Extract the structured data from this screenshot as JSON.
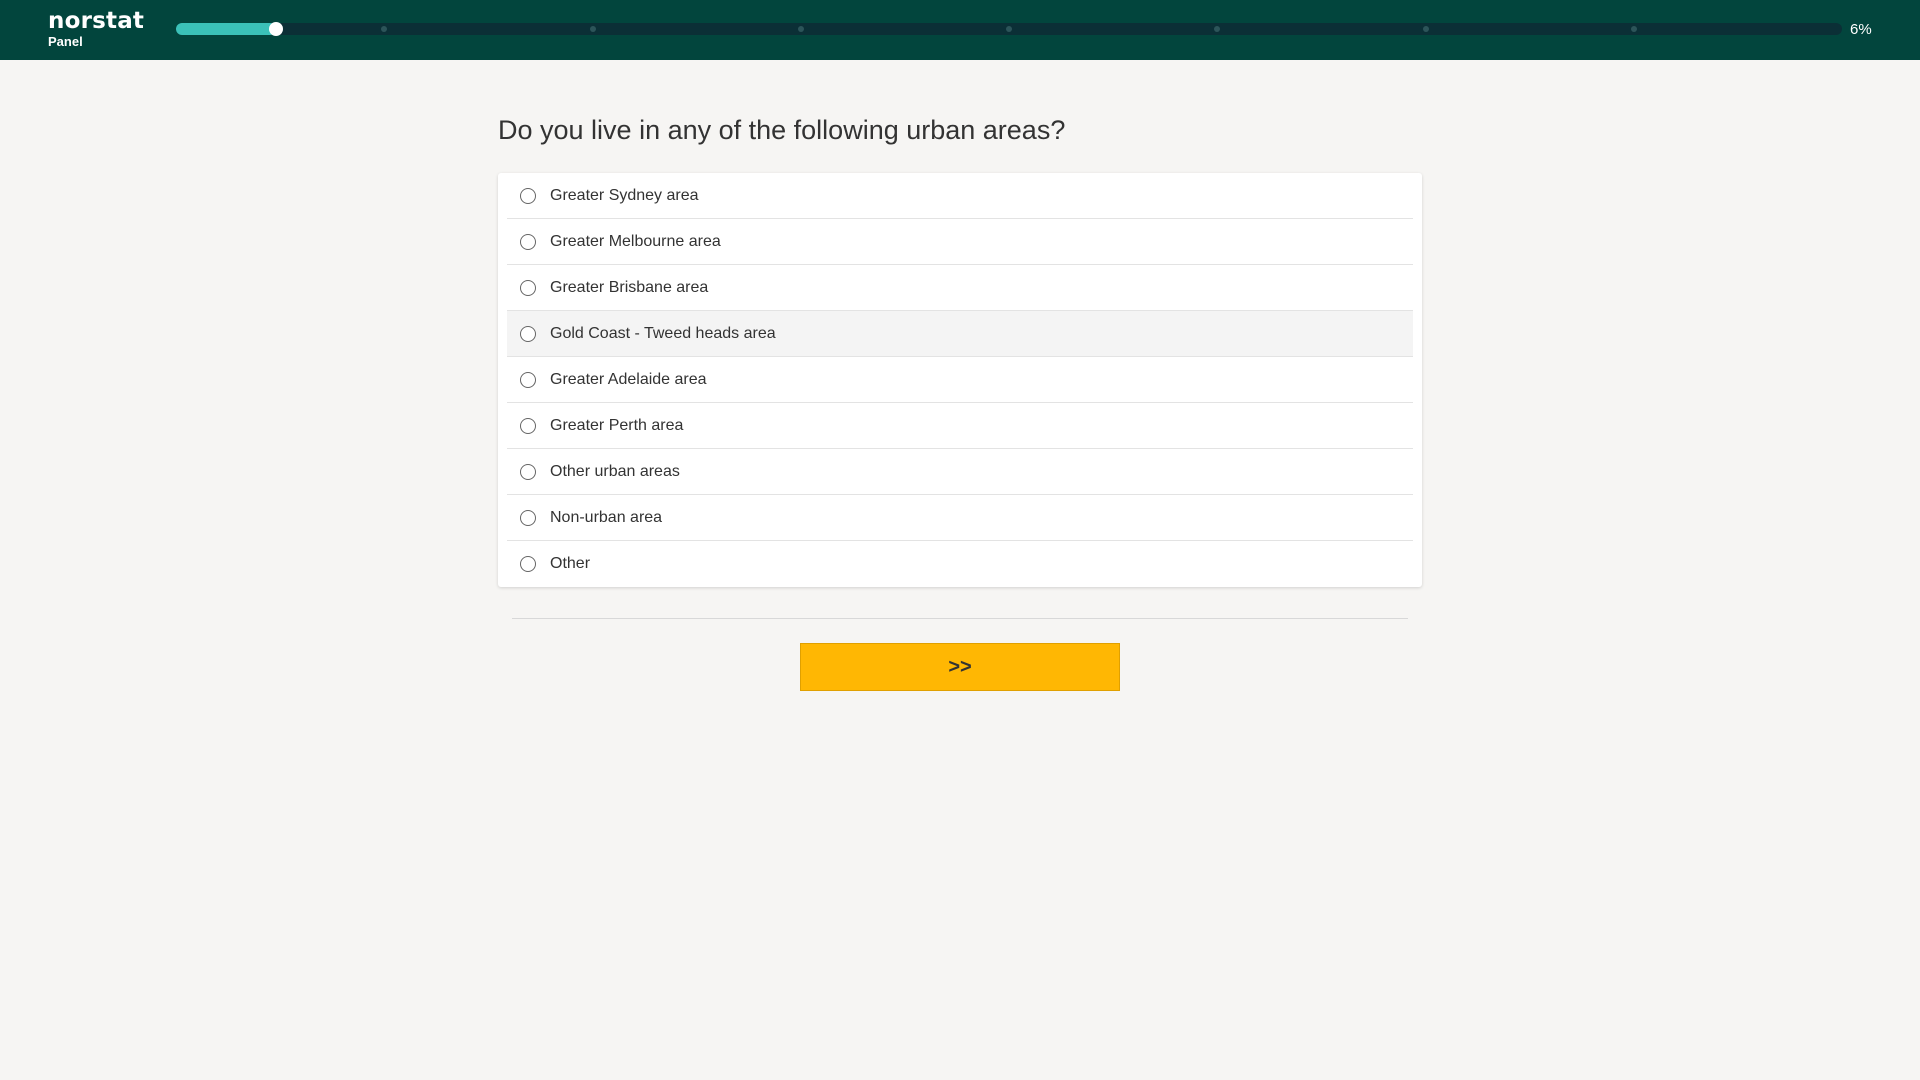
{
  "header": {
    "brand": "norstat",
    "brand_sub": "Panel",
    "progress_fraction": 0.06,
    "progress_label": "6%"
  },
  "question": {
    "text": "Do you live in any of the following urban areas?"
  },
  "options": [
    {
      "label": "Greater Sydney area"
    },
    {
      "label": "Greater Melbourne area"
    },
    {
      "label": "Greater Brisbane area"
    },
    {
      "label": "Gold Coast - Tweed heads area"
    },
    {
      "label": "Greater Adelaide area"
    },
    {
      "label": "Greater Perth area"
    },
    {
      "label": "Other urban areas"
    },
    {
      "label": "Non-urban area"
    },
    {
      "label": "Other"
    }
  ],
  "actions": {
    "next_label": ">>"
  },
  "colors": {
    "header_bg": "#02453d",
    "progress_fill": "#3bc1b8",
    "next_button": "#ffb703"
  }
}
